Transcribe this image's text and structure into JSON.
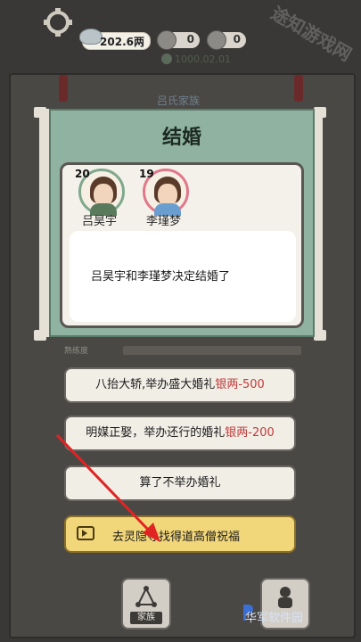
{
  "header": {
    "silver": "202.6两",
    "res1": "0",
    "res2": "0",
    "date": "1000.02.01",
    "family_title": "吕氏家族"
  },
  "modal": {
    "title": "结婚",
    "characters": [
      {
        "name": "吕昊宇",
        "age": "20",
        "ring_color": "#7fa88d",
        "robe_color": "#5a7a5c"
      },
      {
        "name": "李瑾梦",
        "age": "19",
        "ring_color": "#e0788a",
        "robe_color": "#6b9ed0"
      }
    ],
    "message": "吕昊宇和李瑾梦决定结婚了"
  },
  "background": {
    "skill_label": "熟练度"
  },
  "options": {
    "grand": {
      "label": "八抬大轿,举办盛大婚礼",
      "cost": "银两-500"
    },
    "normal": {
      "label": "明媒正娶，举办还行的婚礼",
      "cost": "银两-200"
    },
    "none": {
      "label": "算了不举办婚礼"
    },
    "ad": {
      "label": "去灵隐寺找得道高僧祝福"
    }
  },
  "nav": {
    "family": "家族"
  },
  "watermark": {
    "bottom": "华军软件园",
    "side": "途知游戏网"
  },
  "colors": {
    "modal_bg": "#8fb3a0",
    "cost_red": "#c23a3a",
    "ad_yellow": "#f2d77a",
    "arrow_red": "#e02424"
  }
}
